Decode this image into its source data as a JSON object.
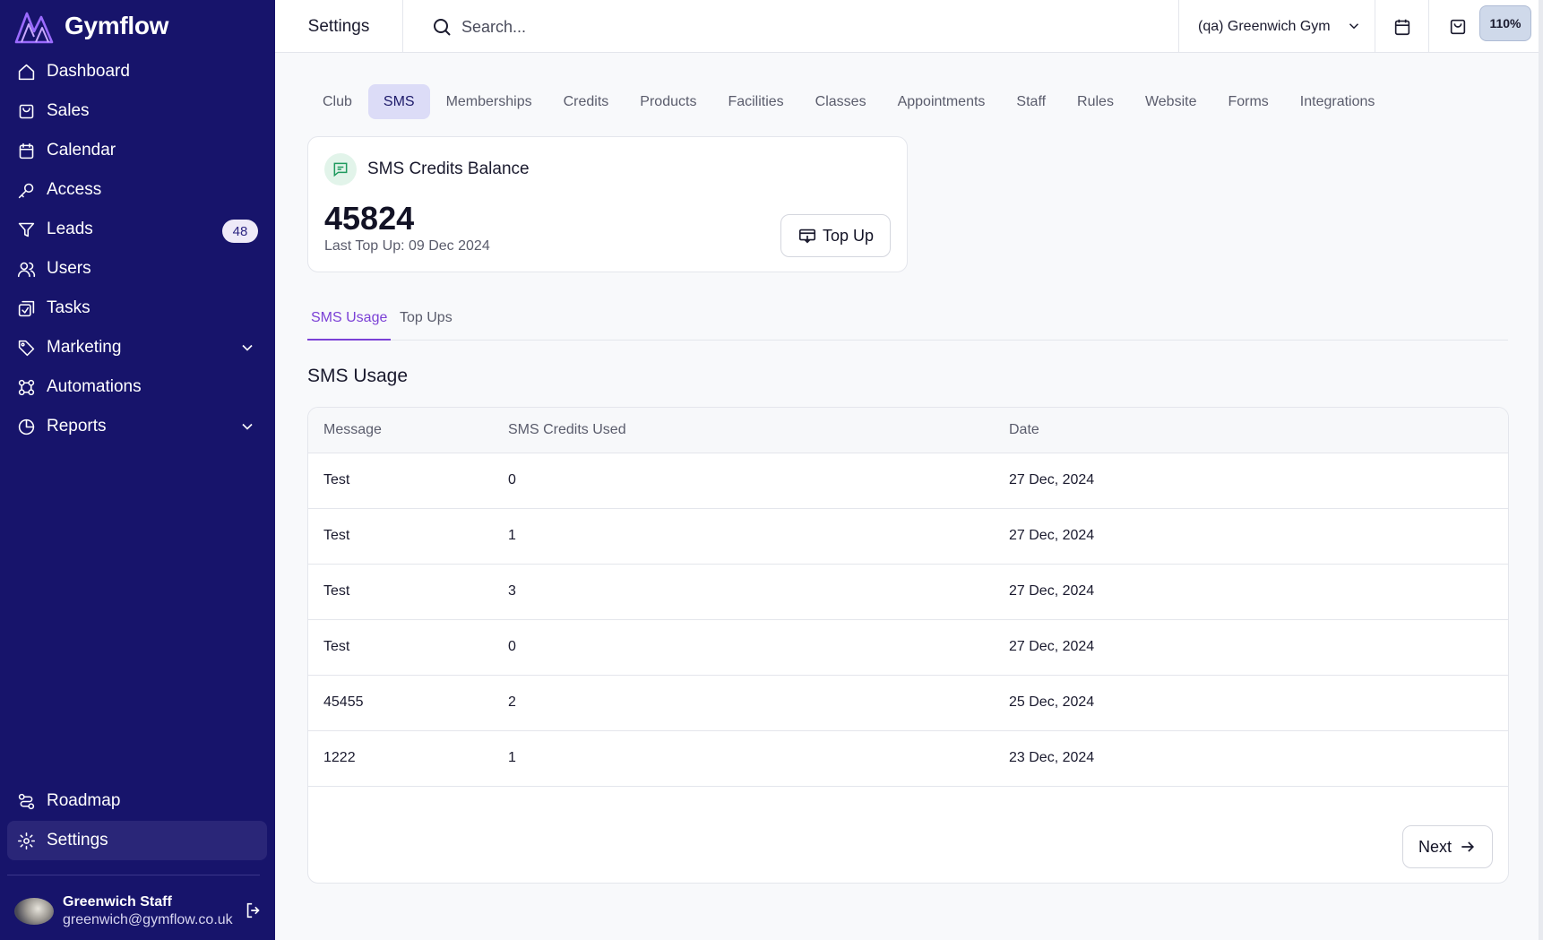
{
  "app": {
    "name": "Gymflow"
  },
  "sidebar": {
    "items": [
      {
        "label": "Dashboard",
        "icon": "home-icon"
      },
      {
        "label": "Sales",
        "icon": "bag-icon"
      },
      {
        "label": "Calendar",
        "icon": "calendar-icon"
      },
      {
        "label": "Access",
        "icon": "key-icon"
      },
      {
        "label": "Leads",
        "icon": "filter-icon",
        "badge": "48"
      },
      {
        "label": "Users",
        "icon": "users-icon"
      },
      {
        "label": "Tasks",
        "icon": "tasks-icon"
      },
      {
        "label": "Marketing",
        "icon": "tag-icon",
        "expandable": true
      },
      {
        "label": "Automations",
        "icon": "automation-icon"
      },
      {
        "label": "Reports",
        "icon": "pie-chart-icon",
        "expandable": true
      }
    ],
    "bottom_items": [
      {
        "label": "Roadmap",
        "icon": "route-icon"
      },
      {
        "label": "Settings",
        "icon": "gear-icon",
        "active": true
      }
    ],
    "user": {
      "name": "Greenwich Staff",
      "email": "greenwich@gymflow.co.uk"
    }
  },
  "topbar": {
    "title": "Settings",
    "search_placeholder": "Search...",
    "club": "(qa) Greenwich Gym",
    "zoom": "110%"
  },
  "settings_tabs": [
    {
      "label": "Club"
    },
    {
      "label": "SMS",
      "active": true
    },
    {
      "label": "Memberships"
    },
    {
      "label": "Credits"
    },
    {
      "label": "Products"
    },
    {
      "label": "Facilities"
    },
    {
      "label": "Classes"
    },
    {
      "label": "Appointments"
    },
    {
      "label": "Staff"
    },
    {
      "label": "Rules"
    },
    {
      "label": "Website"
    },
    {
      "label": "Forms"
    },
    {
      "label": "Integrations"
    }
  ],
  "balance_card": {
    "title": "SMS Credits Balance",
    "balance": "45824",
    "last_top_up": "Last Top Up: 09 Dec 2024",
    "top_up_label": "Top Up"
  },
  "inner_tabs": [
    {
      "label": "SMS Usage",
      "active": true
    },
    {
      "label": "Top Ups"
    }
  ],
  "usage": {
    "title": "SMS Usage",
    "columns": [
      "Message",
      "SMS Credits Used",
      "Date"
    ],
    "rows": [
      [
        "Test",
        "0",
        "27 Dec, 2024"
      ],
      [
        "Test",
        "1",
        "27 Dec, 2024"
      ],
      [
        "Test",
        "3",
        "27 Dec, 2024"
      ],
      [
        "Test",
        "0",
        "27 Dec, 2024"
      ],
      [
        "45455",
        "2",
        "25 Dec, 2024"
      ],
      [
        "1222",
        "1",
        "23 Dec, 2024"
      ]
    ],
    "next_label": "Next"
  },
  "colors": {
    "sidebar_bg": "#17146b",
    "accent": "#7b40d6",
    "active_tab_bg": "#dcdcf7",
    "success_icon": "#1e9a5e"
  }
}
